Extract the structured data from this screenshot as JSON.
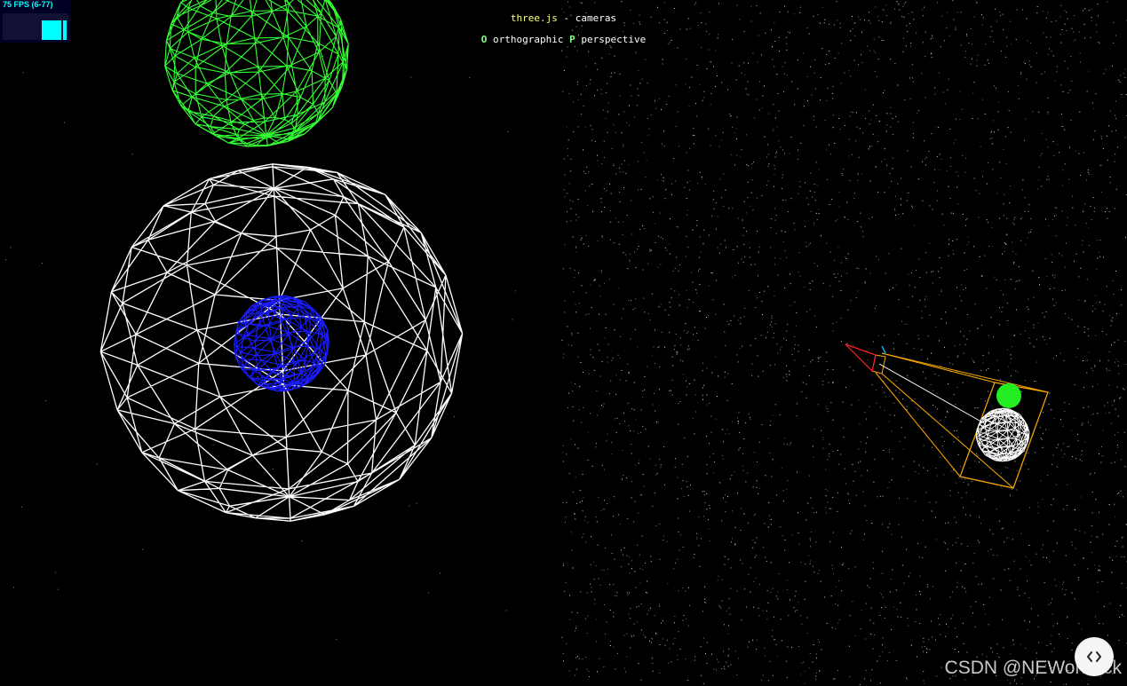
{
  "stats": {
    "fps_text": "75 FPS (6-77)",
    "fps_color": "#00ffff"
  },
  "info": {
    "link_text": "three.js",
    "separator": " - ",
    "title_rest": "cameras",
    "key_o": "O",
    "label_o": " orthographic ",
    "key_p": "P",
    "label_p": " perspective"
  },
  "scene": {
    "left_view": {
      "objects": [
        {
          "name": "white-wireframe-sphere",
          "color": "#ffffff"
        },
        {
          "name": "green-wireframe-sphere",
          "color": "#33ff33"
        },
        {
          "name": "blue-wireframe-sphere",
          "color": "#1a1aff"
        }
      ]
    },
    "right_view": {
      "camera_helper_colors": {
        "frustum": "#ffaa00",
        "cone": "#ff2222",
        "up": "#00aaff",
        "line": "#ffffff"
      }
    }
  },
  "watermark": {
    "text": "CSDN @NEWonclick"
  },
  "code_button": {
    "icon": "code-brackets-icon"
  }
}
